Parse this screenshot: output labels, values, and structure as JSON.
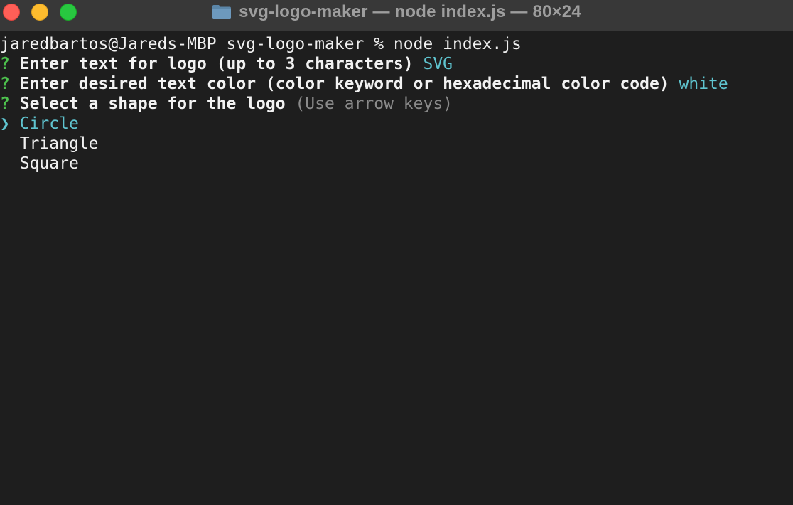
{
  "window": {
    "title": "svg-logo-maker — node index.js — 80×24",
    "folder_icon": "folder-icon"
  },
  "terminal": {
    "command_line": "jaredbartos@Jareds-MBP svg-logo-maker % node index.js",
    "prompts": [
      {
        "marker": "?",
        "question": "Enter text for logo (up to 3 characters)",
        "answer": "SVG"
      },
      {
        "marker": "?",
        "question": "Enter desired text color (color keyword or hexadecimal color code)",
        "answer": "white"
      },
      {
        "marker": "?",
        "question": "Select a shape for the logo",
        "hint": "(Use arrow keys)"
      }
    ],
    "choices": {
      "pointer": "❯",
      "items": [
        "Circle",
        "Triangle",
        "Square"
      ],
      "selected": "Circle"
    }
  },
  "colors": {
    "background": "#1e1e1e",
    "titlebar": "#383838",
    "prompt_marker": "#4ec24e",
    "answer": "#5fc4cf",
    "hint": "#8a8a8a"
  }
}
